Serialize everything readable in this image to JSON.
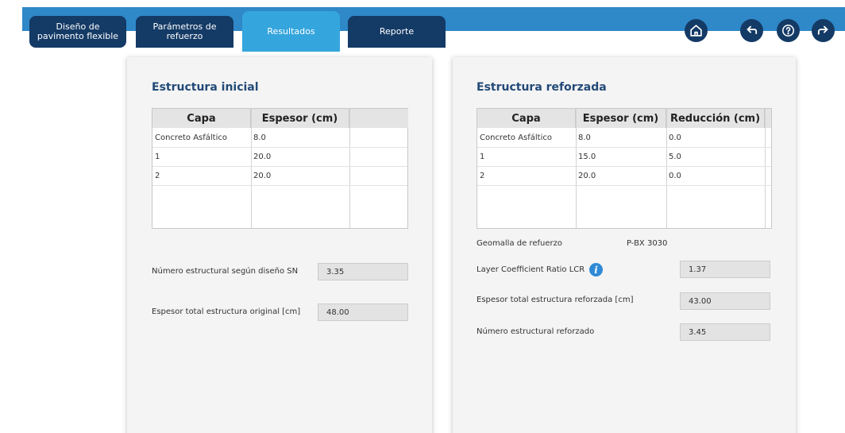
{
  "tabs": [
    {
      "label_line1": "Diseño de",
      "label_line2": "pavimento flexible"
    },
    {
      "label_line1": "Parámetros de",
      "label_line2": "refuerzo"
    },
    {
      "label_line1": "Resultados",
      "label_line2": ""
    },
    {
      "label_line1": "Reporte",
      "label_line2": ""
    }
  ],
  "active_tab": "Resultados",
  "nav_icons": [
    "home-icon",
    "back-icon",
    "help-icon",
    "forward-icon"
  ],
  "colors": {
    "nav_dark": "#143a66",
    "accent": "#35a5dd",
    "title": "#234a78",
    "topbar": "#2f88c8"
  },
  "left": {
    "title": "Estructura inicial",
    "columns": [
      "Capa",
      "Espesor (cm)"
    ],
    "rows": [
      [
        "Concreto Asfáltico",
        "8.0"
      ],
      [
        "1",
        "20.0"
      ],
      [
        "2",
        "20.0"
      ]
    ],
    "sn_label": "Número estructural según diseño SN",
    "sn_value": "3.35",
    "total_label": "Espesor total estructura original [cm]",
    "total_value": "48.00"
  },
  "right": {
    "title": "Estructura reforzada",
    "columns": [
      "Capa",
      "Espesor (cm)",
      "Reducción (cm)"
    ],
    "rows": [
      [
        "Concreto Asfáltico",
        "8.0",
        "0.0"
      ],
      [
        "1",
        "15.0",
        "5.0"
      ],
      [
        "2",
        "20.0",
        "0.0"
      ]
    ],
    "geogrid_label": "Geomalla de refuerzo",
    "geogrid_value": "P-BX 3030",
    "lcr_label": "Layer Coefficient Ratio LCR",
    "lcr_value": "1.37",
    "total_label": "Espesor total estructura reforzada [cm]",
    "total_value": "43.00",
    "sn_label": "Número estructural reforzado",
    "sn_value": "3.45"
  }
}
